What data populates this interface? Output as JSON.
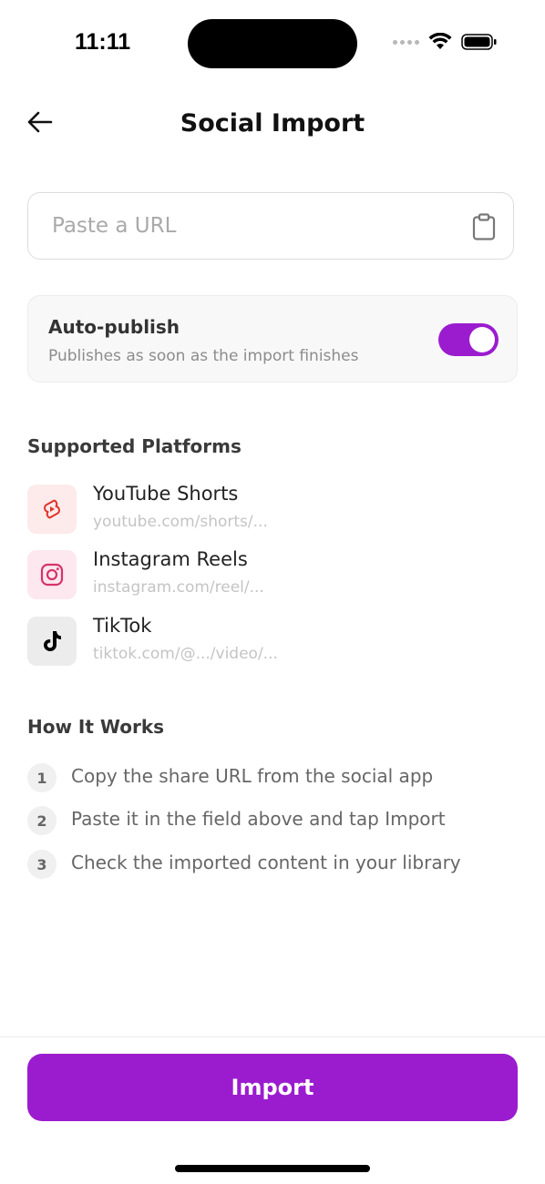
{
  "status_bar": {
    "time": "11:11"
  },
  "header": {
    "title": "Social Import",
    "back_icon": "arrow-left-icon"
  },
  "url_input": {
    "placeholder": "Paste a URL",
    "value": "",
    "paste_icon": "clipboard-icon"
  },
  "auto_publish": {
    "title": "Auto-publish",
    "subtitle": "Publishes as soon as the import finishes",
    "enabled": true
  },
  "platforms": {
    "heading": "Supported Platforms",
    "items": [
      {
        "name": "YouTube Shorts",
        "url": "youtube.com/shorts/...",
        "icon": "youtube-shorts-icon"
      },
      {
        "name": "Instagram Reels",
        "url": "instagram.com/reel/...",
        "icon": "instagram-icon"
      },
      {
        "name": "TikTok",
        "url": "tiktok.com/@.../video/...",
        "icon": "tiktok-icon"
      }
    ]
  },
  "how_it_works": {
    "heading": "How It Works",
    "steps": [
      {
        "number": "1",
        "text": "Copy the share URL from the social app"
      },
      {
        "number": "2",
        "text": "Paste it in the field above and tap Import"
      },
      {
        "number": "3",
        "text": "Check the imported content in your library"
      }
    ]
  },
  "footer": {
    "import_label": "Import"
  },
  "colors": {
    "accent": "#9b1ccf",
    "youtube": "#e0342a",
    "instagram": "#d6336c",
    "tiktok": "#000000"
  }
}
